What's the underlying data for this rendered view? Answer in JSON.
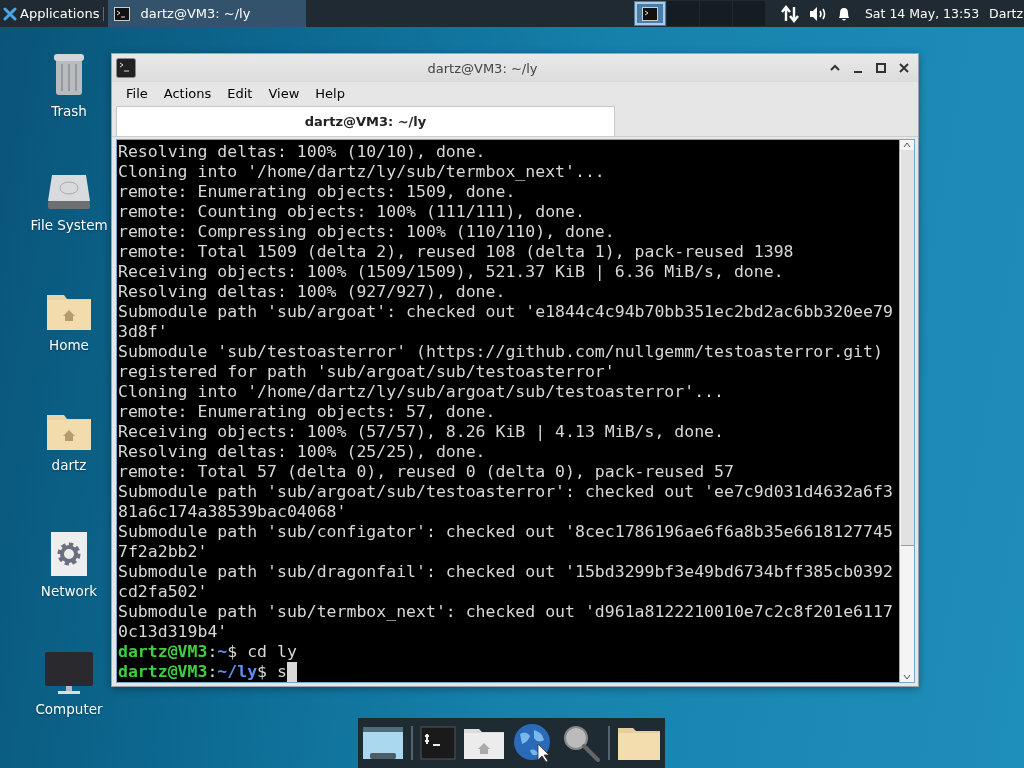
{
  "top_panel": {
    "app_menu": "Applications",
    "tasks": [
      {
        "title": "dartz@VM3: ~/ly",
        "selected": true
      }
    ],
    "workspaces": [
      {
        "selected": true
      },
      {
        "selected": false
      },
      {
        "selected": false
      },
      {
        "selected": false
      }
    ],
    "clock": "Sat 14 May, 13:53",
    "user": "Dartz"
  },
  "desktop_icons": [
    {
      "label": "Trash",
      "kind": "trash"
    },
    {
      "label": "File System",
      "kind": "drive"
    },
    {
      "label": "Home",
      "kind": "home-folder"
    },
    {
      "label": "dartz",
      "kind": "home-folder"
    },
    {
      "label": "Network",
      "kind": "network"
    },
    {
      "label": "Computer",
      "kind": "computer"
    }
  ],
  "window": {
    "title": "dartz@VM3: ~/ly",
    "menu": [
      "File",
      "Actions",
      "Edit",
      "View",
      "Help"
    ],
    "tabs": [
      {
        "label": "dartz@VM3: ~/ly",
        "selected": true
      }
    ],
    "terminal": {
      "lines": [
        "Resolving deltas: 100% (10/10), done.",
        "Cloning into '/home/dartz/ly/sub/termbox_next'...",
        "remote: Enumerating objects: 1509, done.",
        "remote: Counting objects: 100% (111/111), done.",
        "remote: Compressing objects: 100% (110/110), done.",
        "remote: Total 1509 (delta 2), reused 108 (delta 1), pack-reused 1398",
        "Receiving objects: 100% (1509/1509), 521.37 KiB | 6.36 MiB/s, done.",
        "Resolving deltas: 100% (927/927), done.",
        "Submodule path 'sub/argoat': checked out 'e1844c4c94b70bb351ec2bd2ac6bb320ee79",
        "3d8f'",
        "Submodule 'sub/testoasterror' (https://github.com/nullgemm/testoasterror.git)",
        "registered for path 'sub/argoat/sub/testoasterror'",
        "Cloning into '/home/dartz/ly/sub/argoat/sub/testoasterror'...",
        "remote: Enumerating objects: 57, done.",
        "Receiving objects: 100% (57/57), 8.26 KiB | 4.13 MiB/s, done.",
        "Resolving deltas: 100% (25/25), done.",
        "remote: Total 57 (delta 0), reused 0 (delta 0), pack-reused 57",
        "Submodule path 'sub/argoat/sub/testoasterror': checked out 'ee7c9d031d4632a6f3",
        "81a6c174a38539bac04068'",
        "Submodule path 'sub/configator': checked out '8cec1786196ae6f6a8b35e6618127745",
        "7f2a2bb2'",
        "Submodule path 'sub/dragonfail': checked out '15bd3299bf3e49bd6734bff385cb0392",
        "cd2fa502'",
        "Submodule path 'sub/termbox_next': checked out 'd961a8122210010e7c2c8f201e6117",
        "0c13d319b4'"
      ],
      "prompts": [
        {
          "user": "dartz@VM3",
          "separator": ":",
          "path": "~",
          "symbol": "$",
          "command": "cd ly",
          "cursor": false
        },
        {
          "user": "dartz@VM3",
          "separator": ":",
          "path": "~/ly",
          "symbol": "$",
          "command": "s",
          "cursor": true
        }
      ]
    }
  },
  "dock": [
    {
      "kind": "window-list"
    },
    {
      "kind": "separator"
    },
    {
      "kind": "terminal"
    },
    {
      "kind": "home-folder"
    },
    {
      "kind": "globe"
    },
    {
      "kind": "search"
    },
    {
      "kind": "separator"
    },
    {
      "kind": "folder"
    }
  ]
}
